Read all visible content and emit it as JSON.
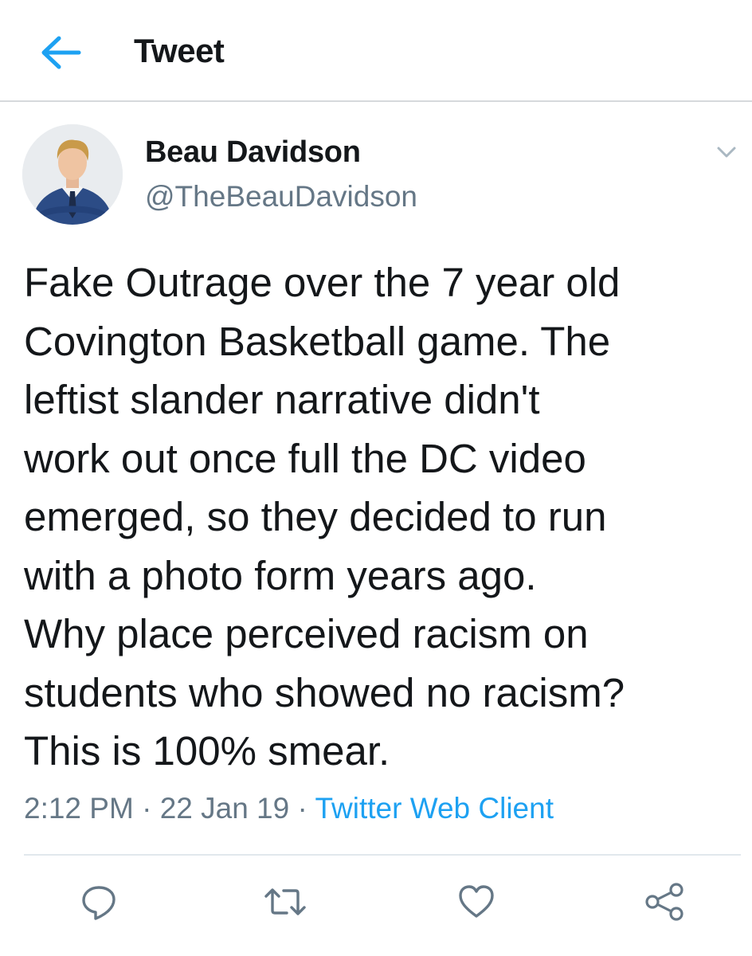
{
  "header": {
    "title": "Tweet",
    "back_icon": "arrow-left-icon",
    "accent_color": "#1da1f2"
  },
  "tweet": {
    "author": {
      "display_name": "Beau Davidson",
      "handle": "@TheBeauDavidson",
      "avatar_icon": "avatar"
    },
    "more_icon": "chevron-down-icon",
    "text_lines": [
      "Fake Outrage over the 7 year old",
      "Covington Basketball game. The",
      "leftist slander narrative didn't",
      "work out once full the DC video",
      "emerged, so they decided to run",
      "with a photo form years ago.",
      "Why place perceived racism on",
      "students who showed no racism?",
      "This is 100% smear."
    ],
    "time": "2:12 PM",
    "separator": "·",
    "date": "22 Jan 19",
    "source": "Twitter Web Client",
    "source_color": "#1da1f2"
  },
  "actions": [
    {
      "name": "reply",
      "icon": "reply-icon"
    },
    {
      "name": "retweet",
      "icon": "retweet-icon"
    },
    {
      "name": "like",
      "icon": "heart-icon"
    },
    {
      "name": "share",
      "icon": "share-icon"
    }
  ]
}
